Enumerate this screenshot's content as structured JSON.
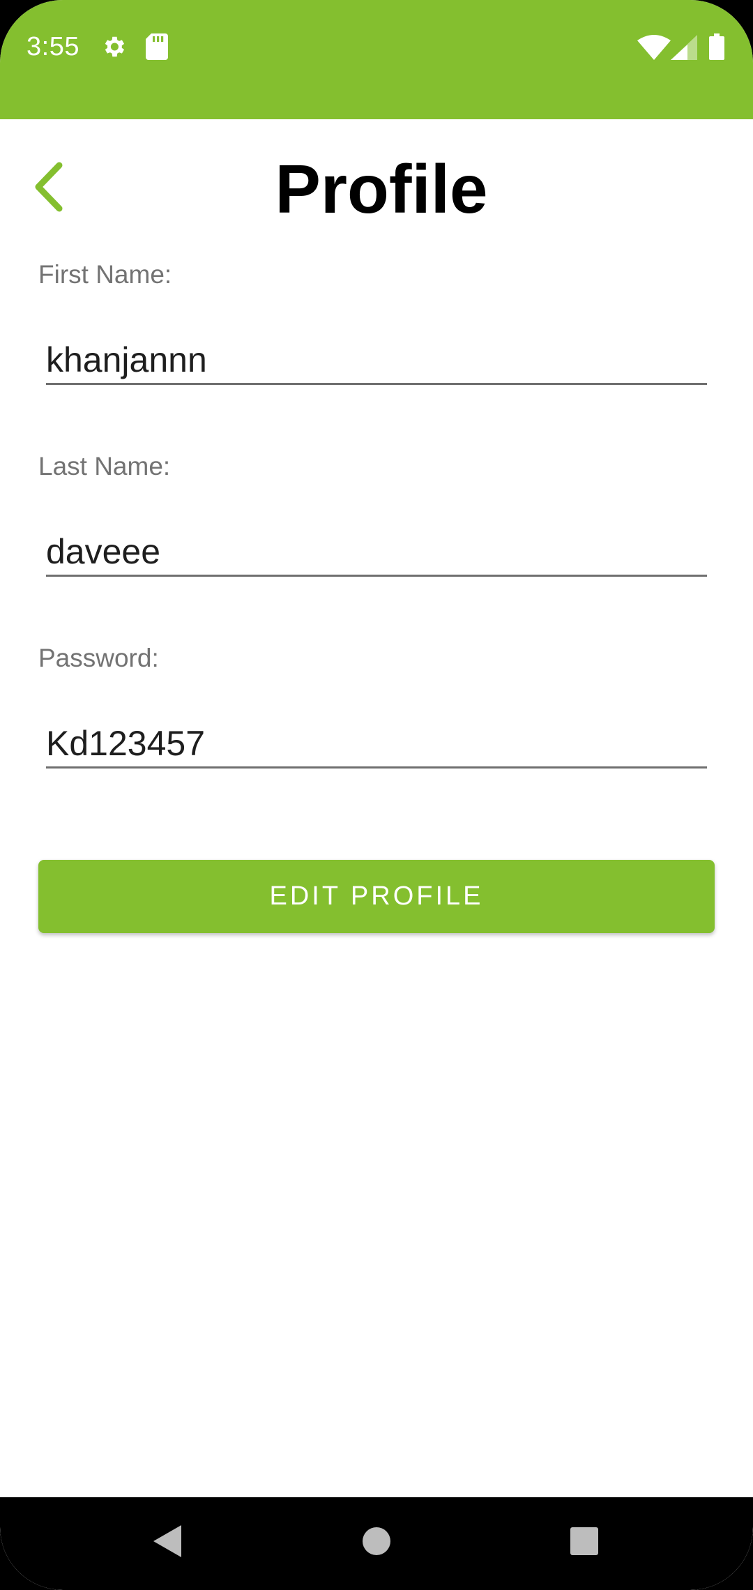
{
  "status_bar": {
    "time": "3:55",
    "background": "#84bf2f",
    "icons": [
      "gear-icon",
      "sd-card-icon",
      "wifi-icon",
      "cell-signal-icon",
      "battery-icon"
    ]
  },
  "header": {
    "title": "Profile",
    "back_icon": "chevron-left-icon"
  },
  "form": {
    "first_name": {
      "label": "First Name:",
      "value": "khanjannn"
    },
    "last_name": {
      "label": "Last Name:",
      "value": "daveee"
    },
    "password": {
      "label": "Password:",
      "value": "Kd123457"
    }
  },
  "actions": {
    "edit_profile_label": "EDIT PROFILE"
  },
  "nav_bar": {
    "icons": [
      "back-triangle-icon",
      "home-circle-icon",
      "recents-square-icon"
    ]
  },
  "colors": {
    "accent": "#84bf2f",
    "label": "#737373",
    "text": "#1e1e1e"
  }
}
